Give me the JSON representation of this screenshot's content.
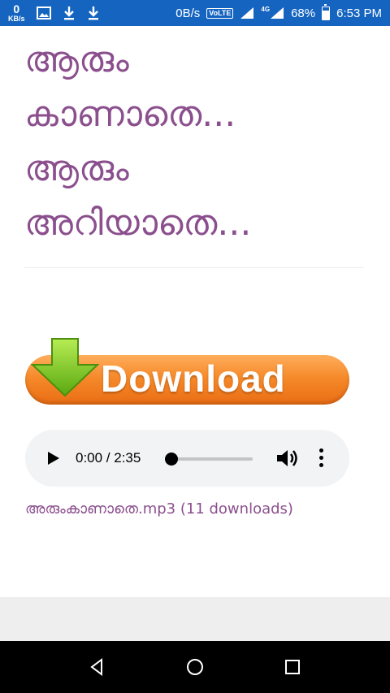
{
  "status_bar": {
    "kb_value": "0",
    "kb_unit": "KB/s",
    "net_speed": "0B/s",
    "volte": "VoLTE",
    "network": "4G",
    "battery_percent": "68%",
    "battery_level": 0.68,
    "time": "6:53 PM",
    "icons": [
      "image-icon",
      "download-icon",
      "download-icon",
      "signal-icon",
      "battery-icon"
    ]
  },
  "post": {
    "title_lines": [
      "ആരും",
      "കാണാതെ...",
      "ആരും",
      "അറിയാതെ..."
    ]
  },
  "download": {
    "label": "Download",
    "colors": {
      "button": "#f58a2a",
      "arrow": "#7ac51e"
    }
  },
  "audio": {
    "time_display": "0:00 / 2:35",
    "progress": 0.0
  },
  "file": {
    "link_text": "അരുംകാണാതെ.mp3 (11 downloads)"
  },
  "colors": {
    "status_bar": "#1565c0",
    "accent": "#8b4f8e",
    "nav_bar": "#000000"
  },
  "nav": {
    "icons": [
      "back-icon",
      "home-icon",
      "recents-icon"
    ]
  }
}
